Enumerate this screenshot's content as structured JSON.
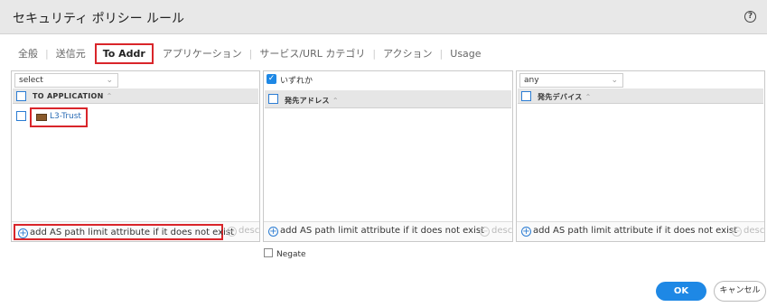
{
  "window": {
    "title": "セキュリティ ポリシー ルール",
    "help_icon": "?"
  },
  "tabs": [
    "全般",
    "送信元",
    "To Addr",
    "アプリケーション",
    "サービス/URL カテゴリ",
    "アクション",
    "Usage"
  ],
  "active_tab": "To Addr",
  "panels": {
    "left": {
      "select_value": "select",
      "column_header": "TO APPLICATION",
      "items": [
        {
          "name": "L3-Trust",
          "icon": "zone-icon"
        }
      ],
      "add_label": "add AS path limit attribute if it does not exist",
      "desc_label": "descr"
    },
    "middle": {
      "checkbox_label": "いずれか",
      "column_header": "発先アドレス",
      "add_label": "add AS path limit attribute if it does not exist",
      "desc_label": "descr",
      "negate_label": "Negate"
    },
    "right": {
      "select_value": "any",
      "column_header": "発先デバイス",
      "add_label": "add AS path limit attribute if it does not exist",
      "desc_label": "descr"
    }
  },
  "buttons": {
    "ok": "OK",
    "cancel": "キャンセル"
  },
  "colors": {
    "accent": "#1e88e5",
    "highlight": "#d9252a",
    "link": "#2b6cb5"
  }
}
